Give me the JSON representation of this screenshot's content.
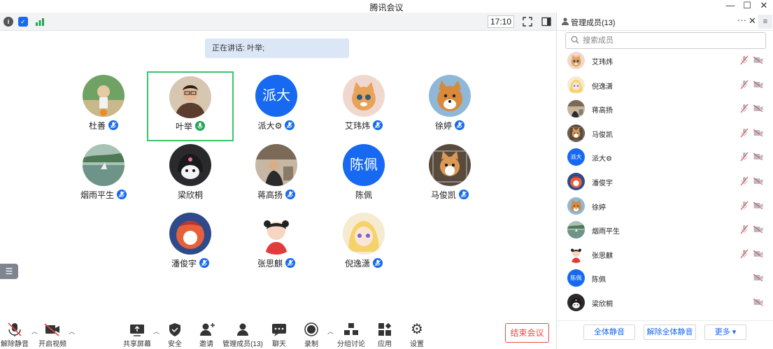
{
  "window": {
    "title": "腾讯会议",
    "minimize": "—",
    "maximize": "☐",
    "close": "✕"
  },
  "topbar": {
    "clock": "17:10",
    "info_glyph": "i",
    "shield_glyph": "✓"
  },
  "speaking_banner": "正在讲话: 叶举;",
  "participants": [
    {
      "name": "杜善",
      "mic": "muted",
      "avatar": "photo-green"
    },
    {
      "name": "叶举",
      "mic": "speaking",
      "avatar": "photo-man",
      "active": true
    },
    {
      "name": "派大⚙",
      "mic": "muted",
      "avatar": "text",
      "avatar_text": "派大"
    },
    {
      "name": "艾玮炜",
      "mic": "muted",
      "avatar": "photo-cat"
    },
    {
      "name": "徐婷",
      "mic": "muted",
      "avatar": "photo-shiba"
    },
    {
      "name": "烟雨平生",
      "mic": "muted",
      "avatar": "photo-lake"
    },
    {
      "name": "梁欣桐",
      "mic": "none",
      "avatar": "photo-kuromi"
    },
    {
      "name": "蒋高扬",
      "mic": "muted",
      "avatar": "photo-room"
    },
    {
      "name": "陈佩",
      "mic": "none",
      "avatar": "text",
      "avatar_text": "陈佩"
    },
    {
      "name": "马俊凯",
      "mic": "muted",
      "avatar": "photo-corgi"
    },
    {
      "name": "潘俊宇",
      "mic": "muted",
      "avatar": "photo-red"
    },
    {
      "name": "张思麒",
      "mic": "muted",
      "avatar": "photo-girl"
    },
    {
      "name": "倪逸潇",
      "mic": "muted",
      "avatar": "photo-anime"
    }
  ],
  "toolbar": {
    "unmute": "解除静音",
    "start_video": "开启视频",
    "share_screen": "共享屏幕",
    "security": "安全",
    "invite": "邀请",
    "manage_members": "管理成员(13)",
    "chat": "聊天",
    "record": "录制",
    "breakout": "分组讨论",
    "apps": "应用",
    "settings": "设置",
    "end_meeting": "结束会议"
  },
  "panel": {
    "title": "管理成员(13)",
    "more": "···",
    "close": "✕",
    "menu": "≡",
    "search_placeholder": "搜索成员",
    "members": [
      {
        "name": "艾玮炜",
        "avatar": "photo-cat",
        "mic_muted": true
      },
      {
        "name": "倪逸潇",
        "avatar": "photo-anime",
        "mic_muted": true
      },
      {
        "name": "蒋高扬",
        "avatar": "photo-room",
        "mic_muted": true
      },
      {
        "name": "马俊凯",
        "avatar": "photo-corgi",
        "mic_muted": true
      },
      {
        "name": "派大⚙",
        "avatar": "text",
        "avatar_text": "派大",
        "mic_muted": true
      },
      {
        "name": "潘俊宇",
        "avatar": "photo-red",
        "mic_muted": true
      },
      {
        "name": "徐婷",
        "avatar": "photo-shiba",
        "mic_muted": true
      },
      {
        "name": "烟雨平生",
        "avatar": "photo-lake",
        "mic_muted": true
      },
      {
        "name": "张思麒",
        "avatar": "photo-girl",
        "mic_muted": true
      },
      {
        "name": "陈佩",
        "avatar": "text",
        "avatar_text": "陈佩",
        "mic_muted": false
      },
      {
        "name": "梁欣桐",
        "avatar": "photo-kuromi",
        "mic_muted": false
      }
    ],
    "mute_all": "全体静音",
    "unmute_all": "解除全体静音",
    "more_options": "更多 ▾"
  },
  "colors": {
    "accent": "#1669f0",
    "speaking": "#3cc46a",
    "end": "#e84a4a"
  }
}
